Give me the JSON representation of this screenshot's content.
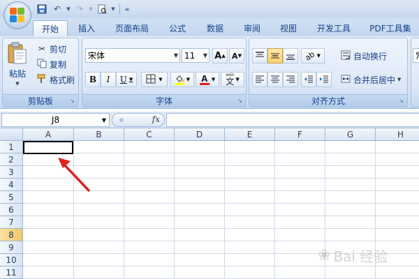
{
  "ribbon": {
    "tabs": [
      {
        "label": "开始",
        "active": true
      },
      {
        "label": "插入"
      },
      {
        "label": "页面布局"
      },
      {
        "label": "公式"
      },
      {
        "label": "数据"
      },
      {
        "label": "审阅"
      },
      {
        "label": "视图"
      },
      {
        "label": "开发工具"
      },
      {
        "label": "PDF工具集"
      }
    ],
    "clipboard": {
      "label": "剪贴板",
      "paste": "粘贴",
      "cut": "剪切",
      "copy": "复制",
      "format_painter": "格式刷"
    },
    "font": {
      "label": "字体",
      "font_name": "宋体",
      "font_size": "11",
      "grow_label": "A",
      "shrink_label": "A",
      "bold": "B",
      "italic": "I",
      "underline": "U",
      "font_color_label": "A",
      "phonetic_label": "文"
    },
    "alignment": {
      "label": "对齐方式",
      "wrap_text": "自动换行",
      "merge_center": "合并后居中"
    },
    "number_partial": "常"
  },
  "formula_bar": {
    "name_box": "J8",
    "fx": "fx",
    "formula": ""
  },
  "sheet": {
    "columns": [
      "A",
      "B",
      "C",
      "D",
      "E",
      "F",
      "G",
      "H"
    ],
    "rows": [
      "1",
      "2",
      "3",
      "4",
      "5",
      "6",
      "7",
      "8",
      "9",
      "10",
      "11"
    ],
    "active_row": "8"
  },
  "watermark": "Bai 经验",
  "colors": {
    "accent_highlight": "#f6c66a",
    "ribbon_bg": "#dbe6f4",
    "arrow": "#e02020"
  }
}
